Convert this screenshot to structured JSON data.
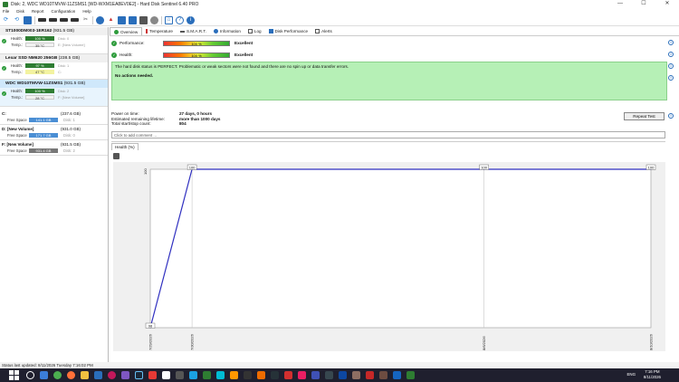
{
  "window": {
    "title": "Disk: 2, WDC WD10TMVW-11ZSMS1 [WD-WXM1EA8EV0E2]  -  Hard Disk Sentinel 6.40 PRO",
    "controls": [
      "—",
      "☐",
      "✕"
    ]
  },
  "menu": [
    "File",
    "Disk",
    "Report",
    "Configuration",
    "Help"
  ],
  "disks": [
    {
      "name": "ST1000DM003-1ER162",
      "capacity": "(931.5 GB)",
      "health": "100 %",
      "temp": "35 °C",
      "extra_health": "Disk: 0",
      "extra_temp": "E: [New Volume]"
    },
    {
      "name": "Lexar SSD NM620 256GB",
      "capacity": "(238.5 GB)",
      "health": "97 %",
      "temp": "47 °C",
      "extra_health": "Disk: 1",
      "extra_temp": "C:"
    },
    {
      "name": "WDC WD10TMVW-11ZSMS1",
      "capacity": "(931.5 GB)",
      "health": "100 %",
      "temp": "28 °C",
      "extra_health": "Disk: 2",
      "extra_temp": "F: [New Volume]"
    }
  ],
  "labels": {
    "health": "Health:",
    "temp": "Temp.:",
    "free_space": "Free Space"
  },
  "volumes": [
    {
      "name": "C:",
      "capacity": "(237.6 GB)",
      "free": "141.1 GB",
      "extra": "Disk: 1"
    },
    {
      "name": "D: [New Volume]",
      "capacity": "(931.0 GB)",
      "free": "171.7 GB",
      "extra": "Disk: 0"
    },
    {
      "name": "F: [New Volume]",
      "capacity": "(931.5 GB)",
      "free": "931.4 GB",
      "extra": "Disk: 2"
    }
  ],
  "tabs": [
    "Overview",
    "Temperature",
    "S.M.A.R.T.",
    "Information",
    "Log",
    "Disk Performance",
    "Alerts"
  ],
  "overview": {
    "performance_label": "Performance:",
    "performance_pct": "100 %",
    "performance_value": "Excellent",
    "health_label": "Health:",
    "health_pct": "100 %",
    "health_value": "Excellent",
    "status_text": "The hard disk status is PERFECT. Problematic or weak sectors were not found and there are no spin up or data transfer errors.",
    "actions": "No actions needed.",
    "power_on_label": "Power on time:",
    "power_on_value": "27 days, 0 hours",
    "lifetime_label": "Estimated remaining lifetime:",
    "lifetime_value": "more than 1000 days",
    "startstop_label": "Total start/stop count:",
    "startstop_value": "804",
    "repeat_test": "Repeat Test",
    "comment_placeholder": "Click to add comment ..."
  },
  "chart_tab": "Health (%)",
  "chart_data": {
    "type": "line",
    "title": "",
    "xlabel": "",
    "ylabel": "",
    "x": [
      "7/29/2026",
      "7/30/2026",
      "8/6/2026",
      "8/10/2026"
    ],
    "values": [
      98,
      100,
      100,
      100
    ],
    "ylim": [
      98,
      100
    ],
    "grid": true,
    "color": "#3030c0"
  },
  "statusbar": "Status last updated: 8/11/2026 Tuesday 7:16:02 PM",
  "taskbar": {
    "lang": "ENG",
    "time": "7:16 PM",
    "date": "8/11/2026"
  }
}
